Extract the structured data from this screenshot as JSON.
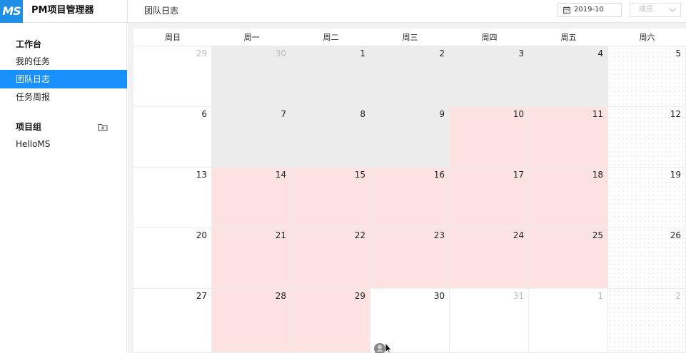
{
  "header": {
    "logo_text": "MS",
    "app_title": "PM项目管理器",
    "page_title": "团队日志",
    "month_value": "2019-10",
    "member_placeholder": "成员"
  },
  "sidebar": {
    "workspace_heading": "工作台",
    "items": [
      {
        "label": "我的任务",
        "active": false
      },
      {
        "label": "团队日志",
        "active": true
      },
      {
        "label": "任务周报",
        "active": false
      }
    ],
    "project_group_heading": "项目组",
    "projects": [
      {
        "label": "HelloMS"
      }
    ]
  },
  "calendar": {
    "weekdays": [
      "周日",
      "周一",
      "周二",
      "周三",
      "周四",
      "周五",
      "周六"
    ],
    "weeks": [
      [
        {
          "day": "29",
          "other": true,
          "shade": "none"
        },
        {
          "day": "30",
          "other": true,
          "shade": "gray"
        },
        {
          "day": "1",
          "other": false,
          "shade": "gray"
        },
        {
          "day": "2",
          "other": false,
          "shade": "gray"
        },
        {
          "day": "3",
          "other": false,
          "shade": "gray"
        },
        {
          "day": "4",
          "other": false,
          "shade": "gray"
        },
        {
          "day": "5",
          "other": false,
          "shade": "dotted"
        }
      ],
      [
        {
          "day": "6",
          "other": false,
          "shade": "none"
        },
        {
          "day": "7",
          "other": false,
          "shade": "gray"
        },
        {
          "day": "8",
          "other": false,
          "shade": "gray"
        },
        {
          "day": "9",
          "other": false,
          "shade": "gray"
        },
        {
          "day": "10",
          "other": false,
          "shade": "pink"
        },
        {
          "day": "11",
          "other": false,
          "shade": "pink"
        },
        {
          "day": "12",
          "other": false,
          "shade": "dotted"
        }
      ],
      [
        {
          "day": "13",
          "other": false,
          "shade": "none"
        },
        {
          "day": "14",
          "other": false,
          "shade": "pink"
        },
        {
          "day": "15",
          "other": false,
          "shade": "pink"
        },
        {
          "day": "16",
          "other": false,
          "shade": "pink"
        },
        {
          "day": "17",
          "other": false,
          "shade": "pink"
        },
        {
          "day": "18",
          "other": false,
          "shade": "pink"
        },
        {
          "day": "19",
          "other": false,
          "shade": "dotted"
        }
      ],
      [
        {
          "day": "20",
          "other": false,
          "shade": "none"
        },
        {
          "day": "21",
          "other": false,
          "shade": "pink"
        },
        {
          "day": "22",
          "other": false,
          "shade": "pink"
        },
        {
          "day": "23",
          "other": false,
          "shade": "pink"
        },
        {
          "day": "24",
          "other": false,
          "shade": "pink"
        },
        {
          "day": "25",
          "other": false,
          "shade": "pink"
        },
        {
          "day": "26",
          "other": false,
          "shade": "dotted"
        }
      ],
      [
        {
          "day": "27",
          "other": false,
          "shade": "none"
        },
        {
          "day": "28",
          "other": false,
          "shade": "pink"
        },
        {
          "day": "29",
          "other": false,
          "shade": "pink"
        },
        {
          "day": "30",
          "other": false,
          "shade": "none"
        },
        {
          "day": "31",
          "other": true,
          "shade": "none"
        },
        {
          "day": "1",
          "other": true,
          "shade": "none"
        },
        {
          "day": "2",
          "other": true,
          "shade": "dotted"
        }
      ]
    ]
  },
  "colors": {
    "accent": "#1890ff",
    "logo_bg": "#1f8fe6",
    "logged_day": "#fde2e2",
    "no_log_day": "#ececec"
  }
}
